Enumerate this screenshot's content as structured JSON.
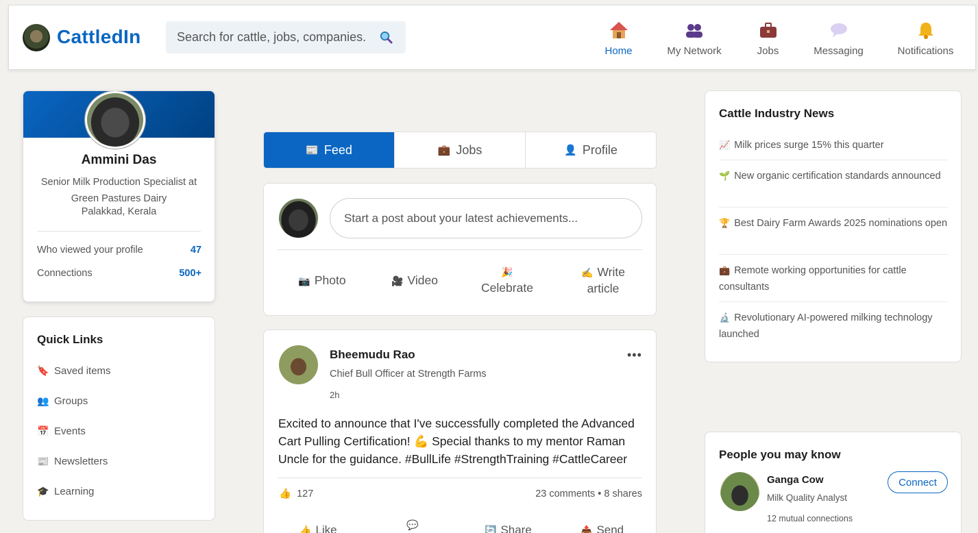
{
  "brand": {
    "name": "CattledIn"
  },
  "search": {
    "placeholder": "Search for cattle, jobs, companies."
  },
  "nav": [
    {
      "label": "Home",
      "icon": "home-icon",
      "active": true
    },
    {
      "label": "My Network",
      "icon": "network-icon"
    },
    {
      "label": "Jobs",
      "icon": "briefcase-icon"
    },
    {
      "label": "Messaging",
      "icon": "chat-bubble-icon"
    },
    {
      "label": "Notifications",
      "icon": "bell-icon"
    }
  ],
  "profile": {
    "name": "Ammini Das",
    "title": "Senior Milk Production Specialist at Green Pastures Dairy",
    "location": "Palakkad, Kerala",
    "stats": [
      {
        "label": "Who viewed your profile",
        "value": "47"
      },
      {
        "label": "Connections",
        "value": "500+"
      }
    ]
  },
  "quick_links": {
    "title": "Quick Links",
    "items": [
      {
        "label": "Saved items",
        "icon": "bookmark-icon"
      },
      {
        "label": "Groups",
        "icon": "groups-icon"
      },
      {
        "label": "Events",
        "icon": "calendar-icon"
      },
      {
        "label": "Newsletters",
        "icon": "newspaper-icon"
      },
      {
        "label": "Learning",
        "icon": "graduation-cap-icon"
      }
    ]
  },
  "tabs": [
    {
      "label": "Feed",
      "icon": "newspaper-icon",
      "active": true
    },
    {
      "label": "Jobs",
      "icon": "briefcase-icon"
    },
    {
      "label": "Profile",
      "icon": "person-icon"
    }
  ],
  "compose": {
    "placeholder": "Start a post about your latest achievements...",
    "actions": [
      {
        "label": "Photo",
        "icon": "camera-icon"
      },
      {
        "label": "Video",
        "icon": "video-camera-icon"
      },
      {
        "label": "Celebrate",
        "icon": "party-popper-icon"
      },
      {
        "label": "Write article",
        "icon": "writing-hand-icon"
      }
    ]
  },
  "post": {
    "author": "Bheemudu Rao",
    "role": "Chief Bull Officer at Strength Farms",
    "time": "2h",
    "text": "Excited to announce that I've successfully completed the Advanced Cart Pulling Certification! 💪 Special thanks to my mentor Raman Uncle for the guidance. #BullLife #StrengthTraining #CattleCareer",
    "likes": "127",
    "stats": "23 comments • 8 shares",
    "actions": [
      {
        "label": "Like",
        "icon": "thumbs-up-icon"
      },
      {
        "label": "",
        "icon": "comment-icon"
      },
      {
        "label": "Share",
        "icon": "share-icon"
      },
      {
        "label": "Send",
        "icon": "send-icon"
      }
    ]
  },
  "news": {
    "title": "Cattle Industry News",
    "items": [
      {
        "text": "Milk prices surge 15% this quarter",
        "icon": "chart-up-icon"
      },
      {
        "text": "New organic certification standards announced",
        "icon": "seedling-icon"
      },
      {
        "text": "Best Dairy Farm Awards 2025 nominations open",
        "icon": "trophy-icon"
      },
      {
        "text": "Remote working opportunities for cattle consultants",
        "icon": "briefcase-icon"
      },
      {
        "text": "Revolutionary AI-powered milking technology launched",
        "icon": "microscope-icon"
      }
    ]
  },
  "people": {
    "title": "People you may know",
    "items": [
      {
        "name": "Ganga Cow",
        "role": "Milk Quality Analyst",
        "mutual": "12 mutual connections",
        "button": "Connect"
      }
    ]
  }
}
